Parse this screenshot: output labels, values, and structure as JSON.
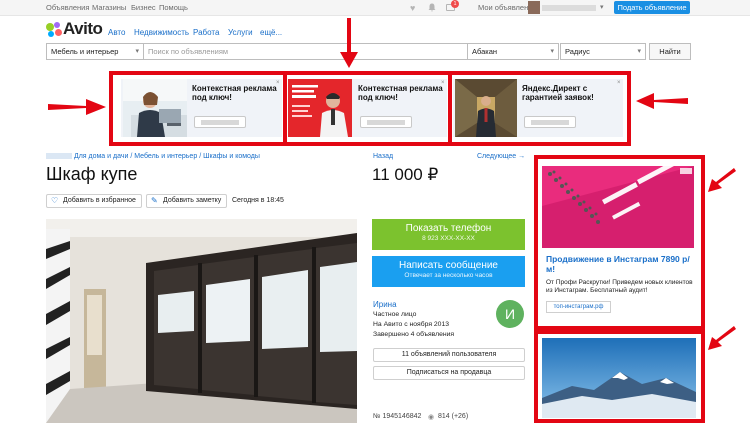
{
  "topbar": {
    "links": [
      "Объявления",
      "Магазины",
      "Бизнес",
      "Помощь"
    ],
    "my_ads": "Мои объявления",
    "notif_count": "1",
    "post_button": "Подать объявление"
  },
  "header": {
    "logo": "Avito",
    "nav": [
      "Авто",
      "Недвижимость",
      "Работа",
      "Услуги",
      "ещё..."
    ]
  },
  "search": {
    "category": "Мебель и интерьер",
    "placeholder": "Поиск по объявлениям",
    "city": "Абакан",
    "radius": "Радиус",
    "find_button": "Найти"
  },
  "top_ads": [
    {
      "title": "Контекстная реклама под ключ!"
    },
    {
      "title": "Контекстная реклама под ключ!"
    },
    {
      "title": "Яндекс.Директ с гарантией заявок!"
    }
  ],
  "listing": {
    "breadcrumbs": [
      "Для дома и дачи",
      "Мебель и интерьер",
      "Шкафы и комоды"
    ],
    "back_link": "Назад",
    "next_link": "Следующее →",
    "title": "Шкаф купе",
    "price": "11 000 ₽",
    "favorite_label": "Добавить в избранное",
    "note_label": "Добавить заметку",
    "date": "Сегодня в 18:45",
    "phone_button": "Показать телефон",
    "phone_masked": "8 923 XXX-XX-XX",
    "message_button": "Написать сообщение",
    "message_sub": "Отвечает за несколько часов",
    "seller_name": "Ирина",
    "seller_type": "Частное лицо",
    "seller_since": "На Авито с ноября 2013",
    "seller_completed": "Завершено 4 объявления",
    "avatar_letter": "И",
    "user_ads_button": "11 объявлений пользователя",
    "subscribe_button": "Подписаться на продавца",
    "ad_number": "№ 1945146842",
    "views": "814 (+26)"
  },
  "right_ad": {
    "title": "Продвижение в Инстаграм 7890 р/м!",
    "text": "От Профи Раскрутки! Приведем новых клиентов из Инстаграм. Бесплатный аудит!",
    "link": "топ-инстаграм.рф"
  },
  "colors": {
    "accent": "#1a8fe3",
    "annotation_red": "#e30613",
    "green_button": "#7cc22e",
    "blue_button": "#1a9ff0"
  }
}
